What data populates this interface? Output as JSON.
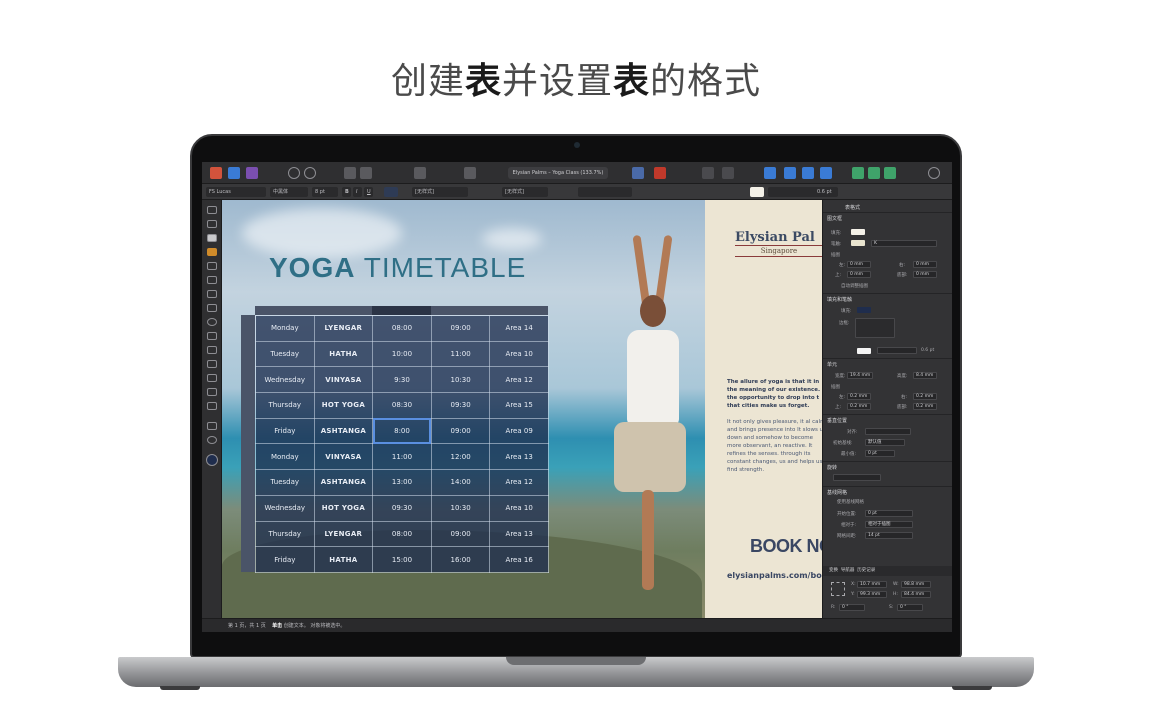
{
  "headline": {
    "part1": "创建",
    "part2": "表",
    "part3": "并设置",
    "part4": "表",
    "part5": "的格式"
  },
  "app": {
    "document_title": "Elysian Palms – Yoga Class (133.7%)",
    "context_bar": {
      "font": "FS Lucas",
      "style": "中黑体",
      "size": "8 pt",
      "bold": "B",
      "italic": "I",
      "underline": "U",
      "char_style": "[无样式]",
      "para_style": "[无样式]",
      "stroke_width": "0.6 pt"
    },
    "status": {
      "page": "第 1 页，共 1 页",
      "hint1": "单击",
      "hint1_text": "创建文本。",
      "hint2_text": "对象将被选中。"
    },
    "accent_color": "#5a8fe0"
  },
  "canvas": {
    "title_bold": "YOGA",
    "title_light": "TIMETABLE",
    "brand_name": "Elysian Pal",
    "brand_sub": "Singapore",
    "blurb_strong": "The allure of yoga is that it in the meaning of our existence. the opportunity to drop into t that cities make us forget.",
    "blurb": "It not only gives pleasure, it al calm and brings presence into It slows us down and somehow to become more observant, an reactive. It refines the senses. through its constant changes, us and helps us find strength.",
    "book_now": "BOOK NO",
    "url": "elysianpalms.com/bo"
  },
  "timetable": {
    "rows": [
      [
        "Monday",
        "LYENGAR",
        "08:00",
        "09:00",
        "Area 14"
      ],
      [
        "Tuesday",
        "HATHA",
        "10:00",
        "11:00",
        "Area 10"
      ],
      [
        "Wednesday",
        "VINYASA",
        "9:30",
        "10:30",
        "Area 12"
      ],
      [
        "Thursday",
        "HOT YOGA",
        "08:30",
        "09:30",
        "Area 15"
      ],
      [
        "Friday",
        "ASHTANGA",
        "8:00",
        "09:00",
        "Area 09"
      ],
      [
        "Monday",
        "VINYASA",
        "11:00",
        "12:00",
        "Area 13"
      ],
      [
        "Tuesday",
        "ASHTANGA",
        "13:00",
        "14:00",
        "Area 12"
      ],
      [
        "Wednesday",
        "HOT YOGA",
        "09:30",
        "10:30",
        "Area 10"
      ],
      [
        "Thursday",
        "LYENGAR",
        "08:00",
        "09:00",
        "Area 13"
      ],
      [
        "Friday",
        "HATHA",
        "15:00",
        "16:00",
        "Area 16"
      ]
    ]
  },
  "panel": {
    "tab": "表格式",
    "section_text_frame": "图文框",
    "fill_label": "填充:",
    "stroke_label": "笔触:",
    "stroke_value": "K",
    "inset_label": "插图",
    "inset_left": "左:",
    "inset_top": "上:",
    "inset_right": "右:",
    "inset_bottom": "底部:",
    "inset_zero": "0 mm",
    "auto_fit": "自动调整插图",
    "section_fill_stroke": "填充和笔触",
    "fill2_label": "填充:",
    "border_label": "边框:",
    "border_width": "0.6 pt",
    "section_cell": "单元",
    "width_label": "宽度:",
    "width_value": "19.4 mm",
    "height_label": "高度:",
    "height_value": "8.4 mm",
    "cell_inset": "插图",
    "cell_left": "左:",
    "cell_top": "上:",
    "cell_right": "右:",
    "cell_bottom": "底部:",
    "cell_inset_value": "0.2 mm",
    "section_text_pos": "垂直位置",
    "align_label": "对齐:",
    "first_baseline_label": "初始基线:",
    "first_baseline_value": "默认值",
    "min_label": "最小值:",
    "min_value": "0 pt",
    "section_rotate": "旋转",
    "section_baseline_grid": "基线网格",
    "use_baseline": "使用基线网格",
    "start_label": "开始位置:",
    "start_value": "0 pt",
    "relative_label": "相对于:",
    "relative_value": "相对于插图",
    "spacing_label": "网格间距:",
    "spacing_value": "14 pt",
    "bottom_tabs": [
      "变换",
      "导航器",
      "历史记录"
    ],
    "x_label": "X:",
    "x_value": "10.7 mm",
    "y_label": "Y:",
    "y_value": "99.3 mm",
    "w_label": "W:",
    "w_value": "98.8 mm",
    "h_label": "H:",
    "h_value": "84.4 mm",
    "r_label": "R:",
    "r_value": "0 °",
    "s_label": "S:",
    "s_value": "0 °"
  }
}
